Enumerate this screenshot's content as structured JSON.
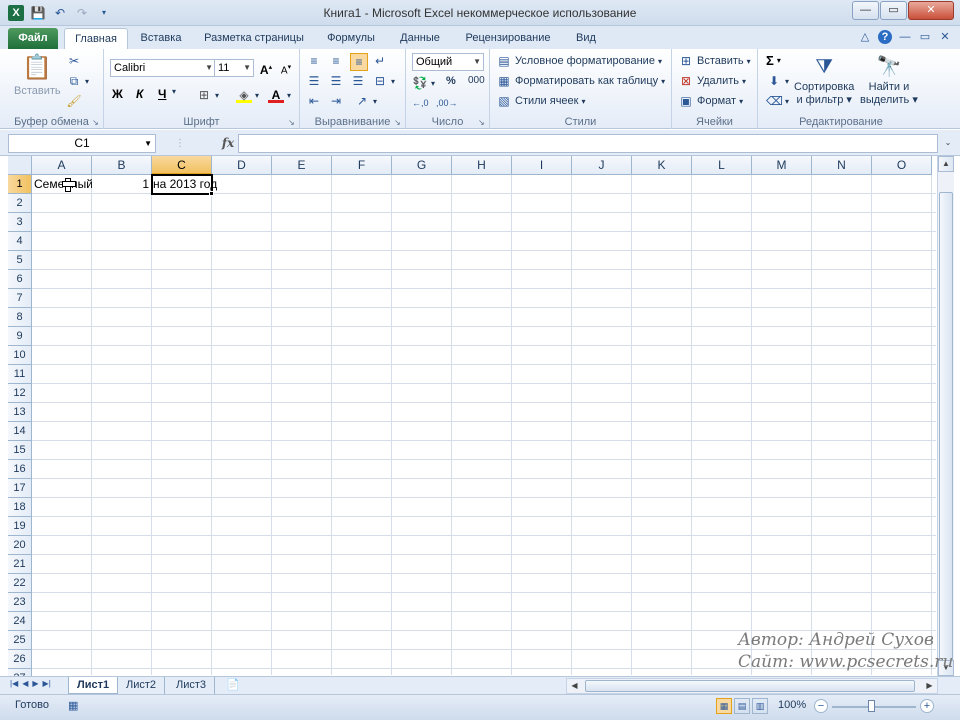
{
  "window": {
    "title": "Книга1  -  Microsoft Excel некоммерческое использование",
    "minimize": "—",
    "maximize": "▭",
    "close": "✕"
  },
  "ribbon_tabs": [
    "Файл",
    "Главная",
    "Вставка",
    "Разметка страницы",
    "Формулы",
    "Данные",
    "Рецензирование",
    "Вид"
  ],
  "ribbon": {
    "clipboard": {
      "paste": "Вставить",
      "label": "Буфер обмена"
    },
    "font": {
      "name": "Calibri",
      "size": "11",
      "bold": "Ж",
      "italic": "К",
      "underline": "Ч",
      "label": "Шрифт"
    },
    "alignment": {
      "label": "Выравнивание"
    },
    "number": {
      "format": "Общий",
      "percent": "%",
      "thousands": "000",
      "label": "Число"
    },
    "styles": {
      "conditional": "Условное форматирование",
      "as_table": "Форматировать как таблицу",
      "cell_styles": "Стили ячеек",
      "label": "Стили"
    },
    "cells": {
      "insert": "Вставить",
      "delete": "Удалить",
      "format": "Формат",
      "label": "Ячейки"
    },
    "editing": {
      "sum": "Σ",
      "sort_l1": "Сортировка",
      "sort_l2": "и фильтр",
      "find_l1": "Найти и",
      "find_l2": "выделить",
      "label": "Редактирование"
    }
  },
  "formula_bar": {
    "name_box": "C1",
    "fx": "fx",
    "value": ""
  },
  "columns": [
    "A",
    "B",
    "C",
    "D",
    "E",
    "F",
    "G",
    "H",
    "I",
    "J",
    "K",
    "L",
    "M",
    "N",
    "O"
  ],
  "selected_column": "C",
  "rows": [
    "1",
    "2",
    "3",
    "4",
    "5",
    "6",
    "7",
    "8",
    "9",
    "10",
    "11",
    "12",
    "13",
    "14",
    "15",
    "16",
    "17",
    "18",
    "19",
    "20",
    "21",
    "22",
    "23",
    "24",
    "25",
    "26",
    "27"
  ],
  "selected_row": "1",
  "cells": {
    "A1": "Семейный",
    "B1": "1",
    "C1": "на 2013 год"
  },
  "sheets": [
    "Лист1",
    "Лист2",
    "Лист3"
  ],
  "active_sheet": "Лист1",
  "status": {
    "text": "Готово",
    "zoom": "100%"
  },
  "watermark": {
    "author": "Автор: Андрей Сухов",
    "site": "Сайт: www.pcsecrets.ru"
  }
}
